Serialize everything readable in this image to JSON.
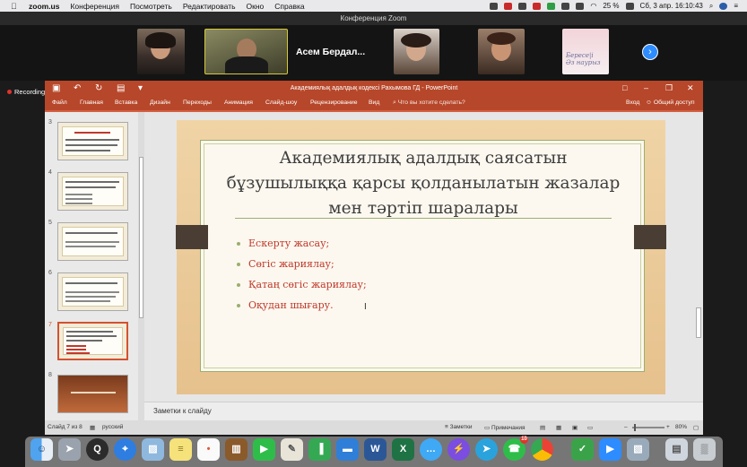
{
  "menubar": {
    "app_name": "zoom.us",
    "items": [
      "Конференция",
      "Посмотреть",
      "Редактировать",
      "Окно",
      "Справка"
    ],
    "battery": "25 %",
    "datetime": "Сб, 3 апр.  16:10:43"
  },
  "zoom": {
    "window_title": "Конференция Zoom",
    "speaker_name": "Асем Бердал...",
    "recording_label": "Recording",
    "greeting_line1": "Бересе|і",
    "greeting_line2": "Әз наурыз"
  },
  "ppt": {
    "window_title": "Академиялық адалдық кодексі Рахымова ГД - PowerPoint",
    "ribbon_tabs": [
      "Файл",
      "Главная",
      "Вставка",
      "Дизайн",
      "Переходы",
      "Анимация",
      "Слайд-шоу",
      "Рецензирование",
      "Вид"
    ],
    "search_placeholder": "Что вы хотите сделать?",
    "login_label": "Вход",
    "share_label": "Общий доступ",
    "slide_numbers": [
      "3",
      "4",
      "5",
      "6",
      "7",
      "8"
    ],
    "slide": {
      "title": "Академиялық адалдық саясатын бұзушылыққа қарсы қолданылатын жазалар мен тәртіп шаралары",
      "bullets": [
        "Ескерту жасау;",
        "Сөгіс жариялау;",
        "Қатаң сөгіс жариялау;",
        "Оқудан шығару."
      ]
    },
    "notes_placeholder": "Заметки к слайду",
    "status": {
      "slide_counter": "Слайд 7 из 8",
      "language": "русский",
      "notes_button": "Заметки",
      "comments_button": "Примечания",
      "zoom_level": "80%"
    }
  },
  "dock": {
    "apps": [
      "finder-icon",
      "launchpad-icon",
      "quicktime-icon",
      "safari-icon",
      "preview-icon",
      "notes-icon",
      "reminders-icon",
      "books-icon",
      "facetime-icon",
      "scripteditor-icon",
      "numbers-icon",
      "keynote-icon",
      "word-icon",
      "excel-icon",
      "messages-icon",
      "messenger-icon",
      "telegram-icon",
      "whatsapp-icon",
      "chrome-icon",
      "vpn-icon",
      "zoom-icon",
      "photos-icon",
      "screenshot-icon",
      "trash-icon"
    ],
    "whatsapp_badge": "10"
  }
}
